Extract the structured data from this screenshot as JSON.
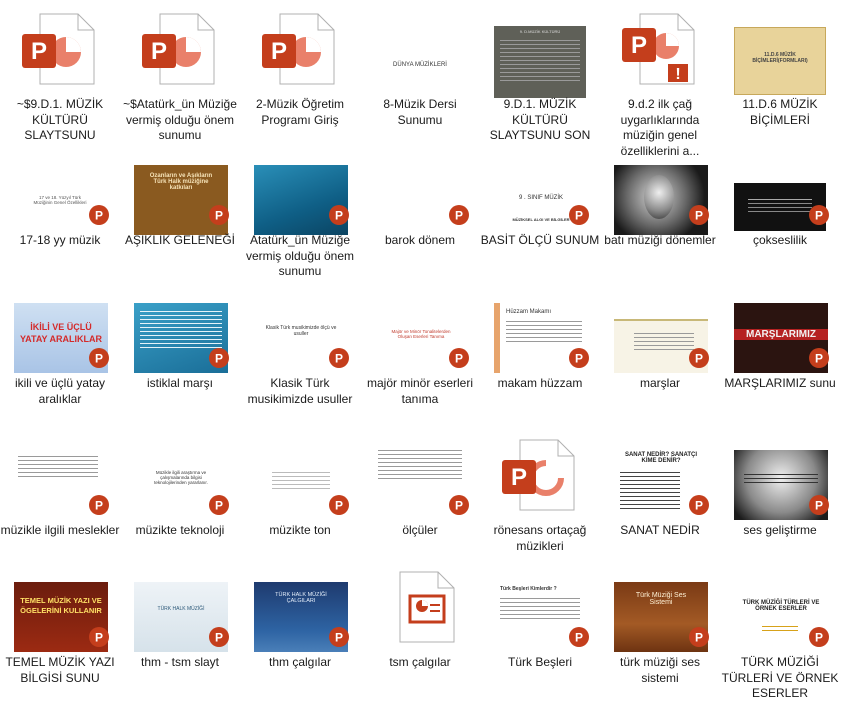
{
  "colors": {
    "ppt_red": "#c43e1c",
    "ppt_dark": "#a0300f",
    "page_bg": "#ffffff",
    "text": "#1a1a1a"
  },
  "items": [
    {
      "label": "~$9.D.1. MÜZİK KÜLTÜRÜ SLAYTSUNU",
      "kind": "ppt-icon"
    },
    {
      "label": "~$Atatürk_ün Müziğe vermiş olduğu önem sunumu",
      "kind": "ppt-icon"
    },
    {
      "label": "2-Müzik Öğretim Programı Giriş",
      "kind": "ppt-icon"
    },
    {
      "label": "8-Müzik Dersi Sunumu",
      "kind": "slide",
      "slide_text": "DÜNYA MÜZİKLERİ"
    },
    {
      "label": "9.D.1. MÜZİK KÜLTÜRÜ SLAYTSUNU SON",
      "kind": "slide",
      "slide_text": "9. D.MÜZİK KÜLTÜRÜ"
    },
    {
      "label": "9.d.2 ilk çağ uygarlıklarında müziğin genel özelliklerini a...",
      "kind": "ppt-warning-icon"
    },
    {
      "label": "11.D.6 MÜZİK BİÇİMLERİ",
      "kind": "slide",
      "slide_text": "11.D.6 MÜZİK BİÇİMLERİ(FORMLARI)"
    },
    {
      "label": "17-18 yy müzik",
      "kind": "slide",
      "slide_text": "17 ve 18. Yüzyıl Türk Müziğinin Genel Özellikleri"
    },
    {
      "label": "AŞIKLIK GELENEĞİ",
      "kind": "slide",
      "slide_text": "Ozanların ve Aşıkların Türk Halk müziğine katkıları"
    },
    {
      "label": "Atatürk_ün Müziğe vermiş olduğu önem sunumu",
      "kind": "slide",
      "slide_text": ""
    },
    {
      "label": "barok dönem",
      "kind": "blank"
    },
    {
      "label": "BASİT ÖLÇÜ SUNUM",
      "kind": "slide",
      "slide_text": "9 . SINIF MÜZİK",
      "slide_text2": "MÜZİKSEL ALGI VE BİLGİLER"
    },
    {
      "label": "batı müziği dönemler",
      "kind": "slide",
      "slide_text": ""
    },
    {
      "label": "çokseslilik",
      "kind": "slide",
      "slide_text": ""
    },
    {
      "label": "ikili ve üçlü yatay aralıklar",
      "kind": "slide",
      "slide_text": "İKİLİ VE ÜÇLÜ YATAY ARALIKLAR"
    },
    {
      "label": "istiklal marşı",
      "kind": "slide",
      "slide_text": ""
    },
    {
      "label": "Klasik Türk musikimizde usuller",
      "kind": "slide",
      "slide_text": "Klasik Türk musikimizde ölçü ve usuller"
    },
    {
      "label": "majör minör eserleri tanıma",
      "kind": "slide",
      "slide_text": "Majör ve Minör Tonalitelerden Oluşan Eserleri Tanıma"
    },
    {
      "label": "makam hüzzam",
      "kind": "slide",
      "slide_text": "Hüzzam Makamı"
    },
    {
      "label": "marşlar",
      "kind": "slide",
      "slide_text": ""
    },
    {
      "label": "MARŞLARIMIZ sunu",
      "kind": "slide",
      "slide_text": "MARŞLARIMIZ"
    },
    {
      "label": "müzikle ilgili meslekler",
      "kind": "slide",
      "slide_text": ""
    },
    {
      "label": "müzikte teknoloji",
      "kind": "slide",
      "slide_text": "Müzikle ilgili araştırma ve çalışmalarında bilgisi teknolojilerinden yararlanır."
    },
    {
      "label": "müzikte ton",
      "kind": "slide",
      "slide_text": ""
    },
    {
      "label": "ölçüler",
      "kind": "slide",
      "slide_text": ""
    },
    {
      "label": "rönesans ortaçağ müzikleri",
      "kind": "ppt-icon-refresh"
    },
    {
      "label": "SANAT NEDİR",
      "kind": "slide",
      "slide_text": "SANAT NEDİR? SANATÇI KİME DENİR?"
    },
    {
      "label": "ses geliştirme",
      "kind": "slide",
      "slide_text": ""
    },
    {
      "label": "TEMEL MÜZİK YAZI BİLGİSİ SUNU",
      "kind": "slide",
      "slide_text": "TEMEL MÜZİK YAZI VE ÖGELERİNİ KULLANIR"
    },
    {
      "label": "thm  - tsm slayt",
      "kind": "slide",
      "slide_text": "TÜRK HALK MÜZİĞİ"
    },
    {
      "label": "thm çalgılar",
      "kind": "slide",
      "slide_text": "TÜRK HALK MÜZİĞİ ÇALGILARI"
    },
    {
      "label": "tsm çalgılar",
      "kind": "generic-ppt-icon"
    },
    {
      "label": "Türk Beşleri",
      "kind": "slide",
      "slide_text": "Türk Beşleri Kimlerdir ?"
    },
    {
      "label": "türk müziği ses sistemi",
      "kind": "slide",
      "slide_text": "Türk Müziği Ses Sistemi"
    },
    {
      "label": "TÜRK MÜZİĞİ TÜRLERİ VE ÖRNEK ESERLER",
      "kind": "slide",
      "slide_text": "TÜRK MÜZİĞİ TÜRLERİ VE ÖRNEK ESERLER"
    }
  ]
}
